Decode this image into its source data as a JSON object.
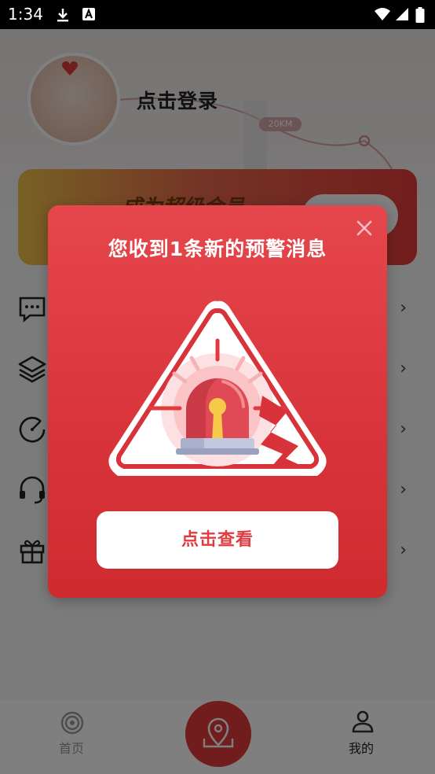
{
  "status_bar": {
    "time": "1:34"
  },
  "profile": {
    "login_text": "点击登录",
    "distance_badge": "20KM"
  },
  "vip_banner": {
    "text": "成为超级会员"
  },
  "menu_items": [
    {
      "icon": "message-icon"
    },
    {
      "icon": "layers-icon"
    },
    {
      "icon": "speedometer-icon"
    },
    {
      "icon": "headset-icon"
    },
    {
      "icon": "gift-icon"
    }
  ],
  "tab_bar": {
    "home_label": "首页",
    "center_icon": "map-pin-icon",
    "mine_label": "我的"
  },
  "dialog": {
    "title": "您收到1条新的预警消息",
    "button_label": "点击查看",
    "close_icon": "close-icon",
    "illustration": "alarm-siren-warning-icon"
  },
  "colors": {
    "dialog_red": "#d8333a",
    "button_text_red": "#e23b3f",
    "accent_red": "#e23a3a"
  }
}
